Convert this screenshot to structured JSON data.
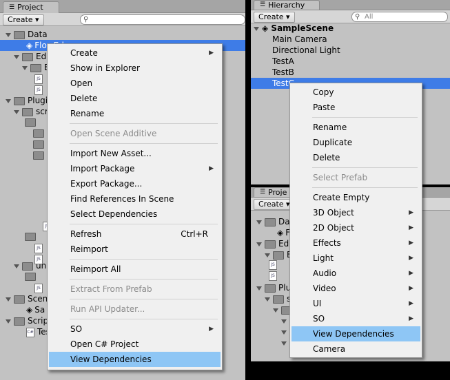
{
  "project_panel": {
    "tab": "Project",
    "create": "Create",
    "tree": [
      {
        "label": "Data",
        "icon": "folder-icon"
      },
      {
        "label": "FlowEd",
        "icon": "unity-icon"
      },
      {
        "label": "Editor",
        "icon": "folder-icon"
      },
      {
        "label": "Edi",
        "icon": "folder-icon"
      },
      {
        "label": "Plugins",
        "icon": "folder-icon"
      },
      {
        "label": "scr",
        "icon": "folder-icon"
      },
      {
        "label": "uni",
        "icon": "folder-icon"
      },
      {
        "label": "Scenes",
        "icon": "folder-icon"
      },
      {
        "label": "Sa",
        "icon": "unity-icon"
      },
      {
        "label": "Scripts",
        "icon": "folder-icon"
      },
      {
        "label": "Tes",
        "icon": "cs-icon"
      }
    ]
  },
  "hierarchy_panel": {
    "tab": "Hierarchy",
    "create": "Create",
    "search_placeholder": "All",
    "scene": "SampleScene",
    "items": [
      "Main Camera",
      "Directional Light",
      "TestA",
      "TestB",
      "TestC"
    ]
  },
  "project_panel2": {
    "tab": "Proje",
    "create": "Create",
    "tree": [
      "Data",
      "F",
      "Edito",
      "E",
      "Plug",
      "s",
      "",
      "",
      "",
      ""
    ]
  },
  "project_menu": {
    "items": [
      {
        "label": "Create",
        "submenu": true
      },
      {
        "label": "Show in Explorer"
      },
      {
        "label": "Open"
      },
      {
        "label": "Delete"
      },
      {
        "label": "Rename"
      },
      {
        "sep": true
      },
      {
        "label": "Open Scene Additive",
        "disabled": true
      },
      {
        "sep": true
      },
      {
        "label": "Import New Asset..."
      },
      {
        "label": "Import Package",
        "submenu": true
      },
      {
        "label": "Export Package..."
      },
      {
        "label": "Find References In Scene"
      },
      {
        "label": "Select Dependencies"
      },
      {
        "sep": true
      },
      {
        "label": "Refresh",
        "shortcut": "Ctrl+R"
      },
      {
        "label": "Reimport"
      },
      {
        "sep": true
      },
      {
        "label": "Reimport All"
      },
      {
        "sep": true
      },
      {
        "label": "Extract From Prefab",
        "disabled": true
      },
      {
        "sep": true
      },
      {
        "label": "Run API Updater...",
        "disabled": true
      },
      {
        "sep": true
      },
      {
        "label": "SO",
        "submenu": true
      },
      {
        "label": "Open C# Project"
      },
      {
        "label": "View Dependencies",
        "highlighted": true
      }
    ]
  },
  "hierarchy_menu": {
    "items": [
      {
        "label": "Copy"
      },
      {
        "label": "Paste"
      },
      {
        "sep": true
      },
      {
        "label": "Rename"
      },
      {
        "label": "Duplicate"
      },
      {
        "label": "Delete"
      },
      {
        "sep": true
      },
      {
        "label": "Select Prefab",
        "disabled": true
      },
      {
        "sep": true
      },
      {
        "label": "Create Empty"
      },
      {
        "label": "3D Object",
        "submenu": true
      },
      {
        "label": "2D Object",
        "submenu": true
      },
      {
        "label": "Effects",
        "submenu": true
      },
      {
        "label": "Light",
        "submenu": true
      },
      {
        "label": "Audio",
        "submenu": true
      },
      {
        "label": "Video",
        "submenu": true
      },
      {
        "label": "UI",
        "submenu": true
      },
      {
        "label": "SO",
        "submenu": true
      },
      {
        "label": "View Dependencies",
        "highlighted": true
      },
      {
        "label": "Camera"
      }
    ]
  },
  "colors": {
    "panel": "#c2c2c2",
    "selection": "#3e7ce7",
    "menu_highlight": "#8ec6f5",
    "menu_bg": "#f0f0f0"
  }
}
